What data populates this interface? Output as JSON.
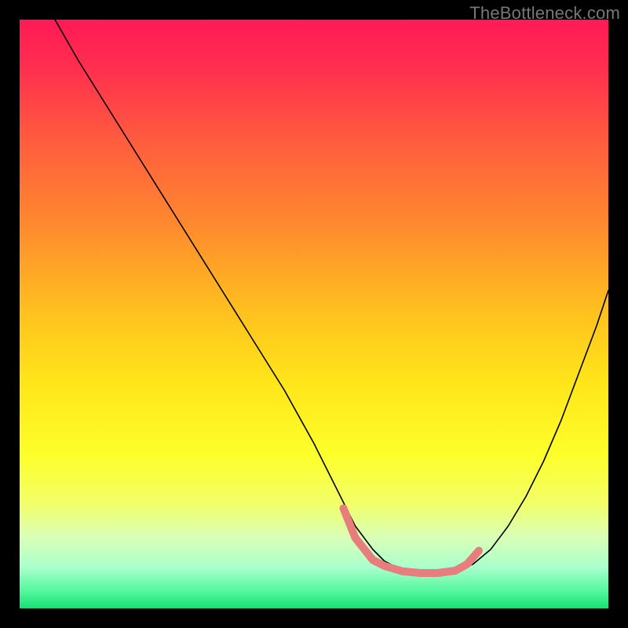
{
  "watermark": "TheBottleneck.com",
  "chart_data": {
    "type": "line",
    "title": "",
    "xlabel": "",
    "ylabel": "",
    "xlim": [
      0,
      100
    ],
    "ylim": [
      0,
      100
    ],
    "grid": false,
    "legend": false,
    "background_gradient": {
      "stops": [
        {
          "offset": 0.0,
          "color": "#ff1a55"
        },
        {
          "offset": 0.08,
          "color": "#ff2e4f"
        },
        {
          "offset": 0.2,
          "color": "#ff5a3f"
        },
        {
          "offset": 0.35,
          "color": "#ff8a2e"
        },
        {
          "offset": 0.5,
          "color": "#ffc21e"
        },
        {
          "offset": 0.62,
          "color": "#ffe61a"
        },
        {
          "offset": 0.74,
          "color": "#fdff2a"
        },
        {
          "offset": 0.82,
          "color": "#f2ff66"
        },
        {
          "offset": 0.88,
          "color": "#d9ffb8"
        },
        {
          "offset": 0.93,
          "color": "#aaffcc"
        },
        {
          "offset": 0.97,
          "color": "#55f7a0"
        },
        {
          "offset": 1.0,
          "color": "#19e074"
        }
      ]
    },
    "series": [
      {
        "name": "bottleneck-curve",
        "color": "#000000",
        "stroke_width": 1.6,
        "x": [
          6,
          10,
          15,
          20,
          25,
          30,
          35,
          40,
          45,
          50,
          54,
          57,
          60,
          62,
          65,
          68,
          71,
          74,
          77,
          80,
          83,
          86,
          89,
          92,
          95,
          98,
          100
        ],
        "y": [
          100,
          93,
          85,
          77,
          69,
          61,
          53,
          45,
          37,
          28,
          20,
          14,
          10,
          8,
          6.5,
          6,
          6,
          6.3,
          7.5,
          10,
          14,
          19,
          25,
          32,
          40,
          48,
          54
        ]
      }
    ],
    "highlight_band": {
      "name": "optimal-range",
      "color": "#e77d7d",
      "stroke_width": 10,
      "linecap": "round",
      "x": [
        55,
        57,
        60,
        62,
        65,
        68,
        71,
        74,
        76,
        78
      ],
      "y": [
        17,
        12,
        8.2,
        7.2,
        6.3,
        6.0,
        6.0,
        6.4,
        7.5,
        9.8
      ]
    }
  }
}
